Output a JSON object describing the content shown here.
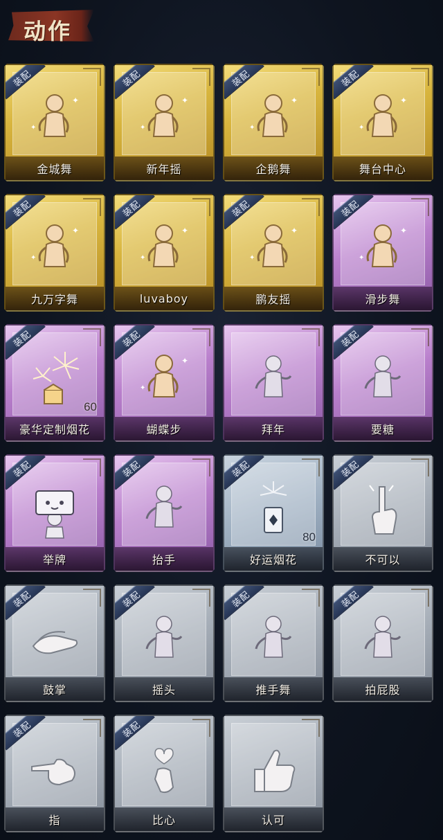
{
  "header": {
    "title": "动作"
  },
  "equip_label": "装配",
  "cards": [
    {
      "name": "金城舞",
      "tier": "gold",
      "equipped": true,
      "icon": "dancer-icon"
    },
    {
      "name": "新年摇",
      "tier": "gold",
      "equipped": true,
      "icon": "dancer-icon"
    },
    {
      "name": "企鹅舞",
      "tier": "gold",
      "equipped": true,
      "icon": "dancer-icon"
    },
    {
      "name": "舞台中心",
      "tier": "gold",
      "equipped": true,
      "icon": "dancer-icon"
    },
    {
      "name": "九万字舞",
      "tier": "gold",
      "equipped": true,
      "icon": "dancer-icon"
    },
    {
      "name": "luvaboy",
      "tier": "gold",
      "equipped": true,
      "icon": "dancer-icon"
    },
    {
      "name": "鹏友摇",
      "tier": "gold",
      "equipped": true,
      "icon": "dancer-icon"
    },
    {
      "name": "滑步舞",
      "tier": "purple",
      "equipped": true,
      "icon": "dancer-icon"
    },
    {
      "name": "豪华定制烟花",
      "tier": "purple",
      "equipped": true,
      "icon": "fireworks-icon",
      "count": "60"
    },
    {
      "name": "蝴蝶步",
      "tier": "purple",
      "equipped": true,
      "icon": "dancer-icon"
    },
    {
      "name": "拜年",
      "tier": "purple",
      "equipped": false,
      "icon": "figure-icon"
    },
    {
      "name": "要糖",
      "tier": "purple",
      "equipped": true,
      "icon": "figure-icon"
    },
    {
      "name": "举牌",
      "tier": "purple",
      "equipped": true,
      "icon": "sign-icon"
    },
    {
      "name": "抬手",
      "tier": "purple",
      "equipped": true,
      "icon": "figure-icon"
    },
    {
      "name": "好运烟花",
      "tier": "blue",
      "equipped": true,
      "icon": "firecracker-icon",
      "count": "80"
    },
    {
      "name": "不可以",
      "tier": "gray",
      "equipped": true,
      "icon": "finger-icon"
    },
    {
      "name": "鼓掌",
      "tier": "gray",
      "equipped": true,
      "icon": "clap-icon"
    },
    {
      "name": "摇头",
      "tier": "gray",
      "equipped": true,
      "icon": "figure-icon"
    },
    {
      "name": "推手舞",
      "tier": "gray",
      "equipped": true,
      "icon": "figure-icon"
    },
    {
      "name": "拍屁股",
      "tier": "gray",
      "equipped": true,
      "icon": "figure-icon"
    },
    {
      "name": "指",
      "tier": "gray",
      "equipped": true,
      "icon": "point-hand-icon"
    },
    {
      "name": "比心",
      "tier": "gray",
      "equipped": true,
      "icon": "heart-hand-icon"
    },
    {
      "name": "认可",
      "tier": "gray",
      "equipped": false,
      "icon": "thumbs-up-icon"
    }
  ]
}
